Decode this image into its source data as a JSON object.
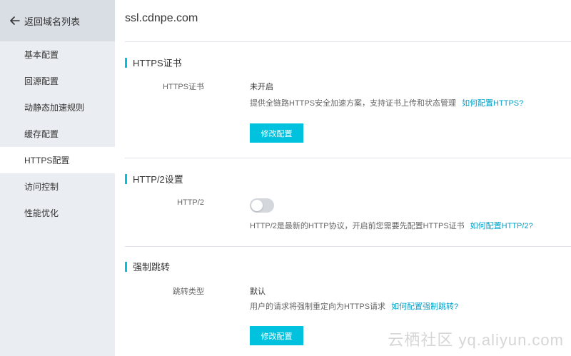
{
  "sidebar": {
    "back_label": "返回域名列表",
    "items": [
      {
        "label": "基本配置"
      },
      {
        "label": "回源配置"
      },
      {
        "label": "动静态加速规则"
      },
      {
        "label": "缓存配置"
      },
      {
        "label": "HTTPS配置"
      },
      {
        "label": "访问控制"
      },
      {
        "label": "性能优化"
      }
    ],
    "active_index": 4
  },
  "main": {
    "domain": "ssl.cdnpe.com",
    "https": {
      "section_title": "HTTPS证书",
      "field_label": "HTTPS证书",
      "status": "未开启",
      "description": "提供全链路HTTPS安全加速方案，支持证书上传和状态管理",
      "help_link": "如何配置HTTPS?",
      "button_label": "修改配置"
    },
    "http2": {
      "section_title": "HTTP/2设置",
      "field_label": "HTTP/2",
      "enabled": false,
      "description": "HTTP/2是最新的HTTP协议，开启前您需要先配置HTTPS证书",
      "help_link": "如何配置HTTP/2?"
    },
    "redirect": {
      "section_title": "强制跳转",
      "field_label": "跳转类型",
      "value": "默认",
      "description": "用户的请求将强制重定向为HTTPS请求",
      "help_link": "如何配置强制跳转?",
      "button_label": "修改配置"
    }
  },
  "watermark": "云栖社区 yq.aliyun.com",
  "colors": {
    "accent": "#00c1de",
    "link": "#00a2ca",
    "sidebar_bg": "#eaedf1"
  }
}
